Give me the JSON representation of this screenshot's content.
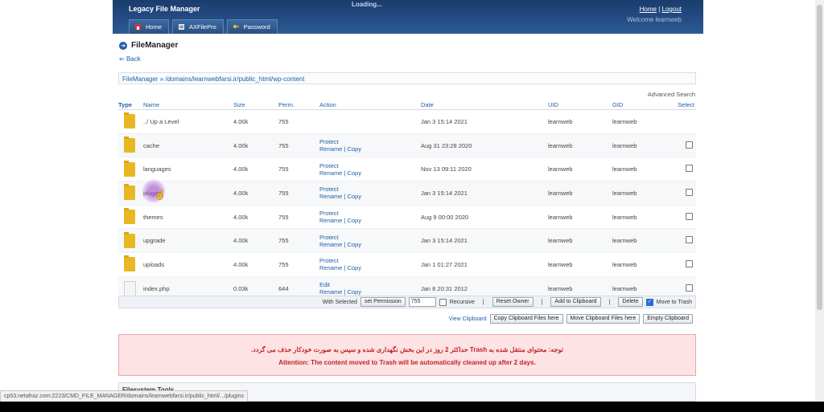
{
  "header": {
    "brand": "Legacy File Manager",
    "loading": "Loading...",
    "home_link": "Home",
    "logout_link": "Logout",
    "link_sep": "|",
    "welcome": "Welcome learnweb",
    "tabs": [
      "Home",
      "AXFilePro",
      "Password"
    ]
  },
  "page": {
    "title": "FileManager",
    "back": "Back",
    "breadcrumb": "FileManager » /domains/learnwebfarsi.ir/public_html/wp-content",
    "advanced_search": "Advanced Search"
  },
  "table": {
    "headers": [
      "Type",
      "Name",
      "Size",
      "Perm.",
      "Action",
      "Date",
      "UID",
      "GID",
      "Select"
    ],
    "rows": [
      {
        "type": "folder",
        "name": "../ Up a Level",
        "size": "4.00k",
        "perm": "755",
        "action1": "",
        "action2": "",
        "date": "Jan 3 15:14 2021",
        "uid": "learnweb",
        "gid": "learnweb",
        "select": false
      },
      {
        "type": "folder",
        "name": "cache",
        "size": "4.00k",
        "perm": "755",
        "action1": "Protect",
        "action2": "Rename | Copy",
        "date": "Aug 31 23:28 2020",
        "uid": "learnweb",
        "gid": "learnweb",
        "select": true
      },
      {
        "type": "folder",
        "name": "languages",
        "size": "4.00k",
        "perm": "755",
        "action1": "Protect",
        "action2": "Rename | Copy",
        "date": "Nov 13 09:11 2020",
        "uid": "learnweb",
        "gid": "learnweb",
        "select": true
      },
      {
        "type": "folder",
        "name": "plugins",
        "size": "4.00k",
        "perm": "755",
        "action1": "Protect",
        "action2": "Rename | Copy",
        "date": "Jan 3 15:14 2021",
        "uid": "learnweb",
        "gid": "learnweb",
        "select": true
      },
      {
        "type": "folder",
        "name": "themes",
        "size": "4.00k",
        "perm": "755",
        "action1": "Protect",
        "action2": "Rename | Copy",
        "date": "Aug 9 00:00 2020",
        "uid": "learnweb",
        "gid": "learnweb",
        "select": true
      },
      {
        "type": "folder",
        "name": "upgrade",
        "size": "4.00k",
        "perm": "755",
        "action1": "Protect",
        "action2": "Rename | Copy",
        "date": "Jan 3 15:14 2021",
        "uid": "learnweb",
        "gid": "learnweb",
        "select": true
      },
      {
        "type": "folder",
        "name": "uploads",
        "size": "4.00k",
        "perm": "755",
        "action1": "Protect",
        "action2": "Rename | Copy",
        "date": "Jan 1 01:27 2021",
        "uid": "learnweb",
        "gid": "learnweb",
        "select": true
      },
      {
        "type": "file",
        "name": "index.php",
        "size": "0.03k",
        "perm": "644",
        "action1": "Edit",
        "action2": "Rename | Copy",
        "date": "Jan 8 20:31 2012",
        "uid": "learnweb",
        "gid": "learnweb",
        "select": true
      }
    ]
  },
  "toolbar": {
    "with_selected": "With Selected",
    "set_permission": "set Permission",
    "permission_value": "755",
    "recursive": "Recursive",
    "reset_owner": "Reset Owner",
    "add_to_clipboard": "Add to Clipboard",
    "delete": "Delete",
    "move_to_trash": "Move to Trash",
    "separator": "|",
    "view_clipboard": "View Clipboard",
    "copy_clipboard": "Copy Clipboard Files here",
    "move_clipboard": "Move Clipboard Files here",
    "empty_clipboard": "Empty Clipboard"
  },
  "notice": {
    "farsi": "توجه: محتوای منتقل شده به Trash حداکثر 2 روز در این بخش نگهداری شده و سپس به صورت خودکار حذف می گردد.",
    "english": "Attention: The content moved to Trash will be automatically cleaned up after 2 days."
  },
  "tools": {
    "title": "Filesystem Tools"
  },
  "status_bar": "cp53.netafraz.com:2223/CMD_FILE_MANAGER/domains/learnwebfarsi.ir/public_html/.../plugins"
}
